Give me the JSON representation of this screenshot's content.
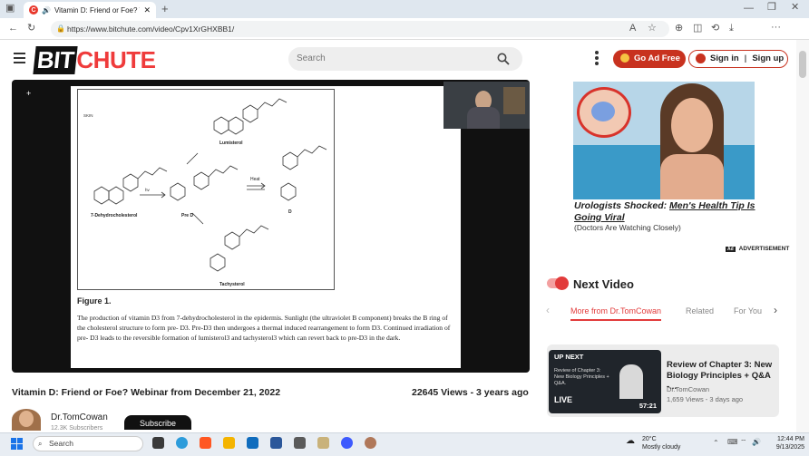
{
  "browser": {
    "tab_title": "Vitamin D: Friend or Foe? We",
    "url": "https://www.bitchute.com/video/Cpv1XrGHXBB1/"
  },
  "site": {
    "logo_bit": "BIT",
    "logo_chute": "CHUTE",
    "search_placeholder": "Search",
    "go_ad_free": "Go Ad Free",
    "sign_in": "Sign in",
    "sign_up": "Sign up",
    "brand_color": "#ef3b3b"
  },
  "video": {
    "slide": {
      "labels": {
        "lumisterol": "Lumisterol",
        "dehydro": "7-Dehydrocholesterol",
        "pre_d3": "Pre D",
        "d3": "D",
        "heat": "Heat",
        "tachysterol": "Tachysterol",
        "uv": "hv"
      },
      "figure_title": "Figure 1.",
      "figure_text": "The production of vitamin D3 from 7-dehydrocholesterol in the epidermis. Sunlight (the ultraviolet B component) breaks the B ring of the cholesterol structure to form pre- D3. Pre-D3 then undergoes a thermal induced rearrangement to form D3. Continued irradiation of pre- D3 leads to the reversible formation of lumisterol3 and tachysterol3 which can revert back to pre-D3 in the dark."
    },
    "title": "Vitamin D: Friend or Foe? Webinar from December 21, 2022",
    "views": "22645 Views - 3 years ago",
    "channel": "Dr.TomCowan",
    "subscribe": "Subscribe"
  },
  "ad": {
    "headline_a": "Urologists Shocked: ",
    "headline_b": "Men's Health Tip Is Going Viral",
    "sub": "(Doctors Are Watching Closely)",
    "label": "ADVERTISEMENT"
  },
  "next": {
    "heading": "Next Video",
    "tabs": [
      "More from Dr.TomCowan",
      "Related",
      "For You"
    ],
    "card": {
      "badge": "UP NEXT",
      "thumb_text": "Review of Chapter 3: New Biology Principles + Q&A.",
      "live": "LIVE",
      "duration": "57:21",
      "title": "Review of Chapter 3: New Biology Principles + Q&A -...",
      "channel": "Dr.TomCowan",
      "meta": "1,659 Views - 3 days ago"
    }
  },
  "taskbar": {
    "search": "Search",
    "temp": "20°C",
    "weather": "Mostly cloudy",
    "time": "12:44 PM",
    "date": "9/13/2025"
  }
}
